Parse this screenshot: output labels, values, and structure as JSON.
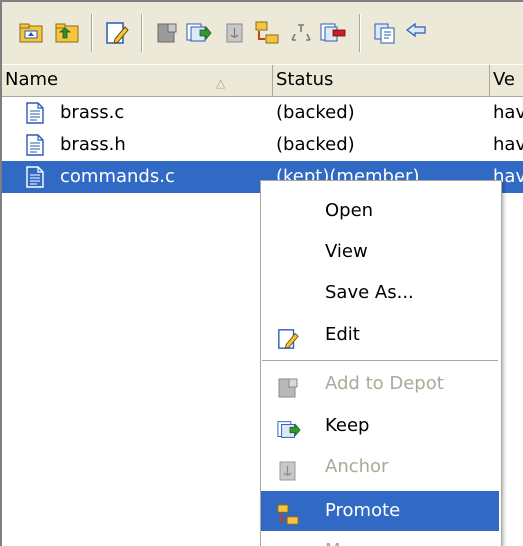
{
  "toolbar": {
    "icons": [
      "folder-up-icon",
      "folder-parent-icon",
      "edit-icon",
      "add-to-depot-icon",
      "keep-icon",
      "anchor-icon",
      "promote-icon",
      "merge-icon",
      "remove-icon",
      "copy-icon",
      "swap-icon"
    ]
  },
  "columns": {
    "name": "Name",
    "status": "Status",
    "version": "Ve"
  },
  "rows": [
    {
      "icon": "text-file-icon",
      "name": "brass.c",
      "status": "(backed)",
      "version": "hav"
    },
    {
      "icon": "text-file-icon",
      "name": "brass.h",
      "status": "(backed)",
      "version": "hav"
    },
    {
      "icon": "text-file-icon",
      "name": "commands.c",
      "status": "(kept)(member)",
      "version": "hav",
      "selected": true
    }
  ],
  "context_menu": {
    "items": [
      {
        "label": "Open",
        "enabled": true
      },
      {
        "label": "View",
        "enabled": true
      },
      {
        "label": "Save As...",
        "enabled": true
      },
      {
        "label": "Edit",
        "icon": "edit-icon",
        "enabled": true
      },
      {
        "label": "Add to Depot",
        "icon": "add-to-depot-icon",
        "enabled": false
      },
      {
        "label": "Keep",
        "icon": "keep-icon",
        "enabled": true
      },
      {
        "label": "Anchor",
        "icon": "anchor-icon",
        "enabled": false
      },
      {
        "label": "Promote",
        "icon": "promote-icon",
        "enabled": true,
        "highlighted": true
      },
      {
        "label": "Merge",
        "icon": "merge-icon",
        "enabled": false
      }
    ]
  },
  "colors": {
    "selection": "#316ac5",
    "chrome": "#ece9d8",
    "disabled_text": "#aca899"
  }
}
